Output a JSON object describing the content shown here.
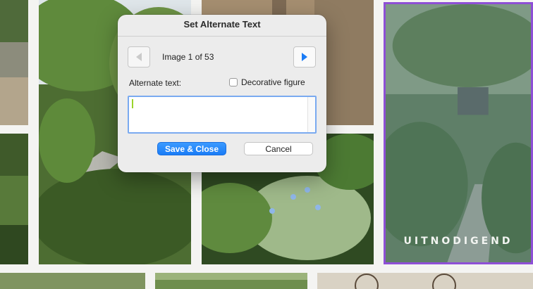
{
  "dialog": {
    "title": "Set Alternate Text",
    "counter": "Image 1 of 53",
    "alt_label": "Alternate text:",
    "decorative_label": "Decorative figure",
    "decorative_checked": false,
    "alt_value": "",
    "save_label": "Save & Close",
    "cancel_label": "Cancel"
  },
  "selected_photo": {
    "overlay_text": "UITNODIGEND",
    "border_color": "#8e4fd6"
  },
  "colors": {
    "accent": "#1a7cf6",
    "focus_ring": "#7aaaf0",
    "caret": "#9bd42c"
  },
  "icons": {
    "prev": "chevron-left-icon",
    "next": "chevron-right-icon"
  }
}
